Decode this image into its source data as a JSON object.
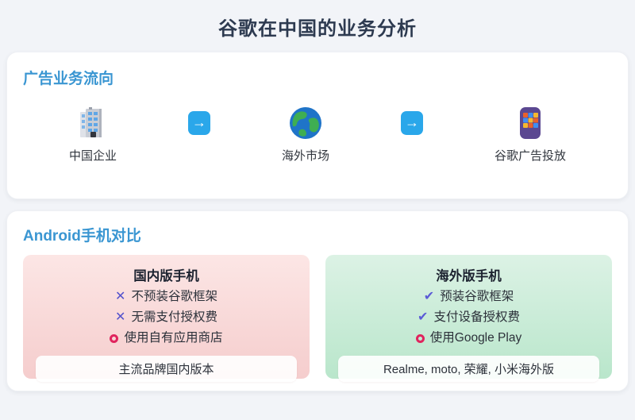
{
  "page": {
    "title": "谷歌在中国的业务分析"
  },
  "ad_flow": {
    "heading": "广告业务流向",
    "arrow_glyph": "→",
    "nodes": [
      {
        "icon": "building-icon",
        "label": "中国企业"
      },
      {
        "icon": "globe-icon",
        "label": "海外市场"
      },
      {
        "icon": "phone-icon",
        "label": "谷歌广告投放"
      }
    ]
  },
  "comparison": {
    "heading": "Android手机对比",
    "domestic": {
      "title": "国内版手机",
      "items": [
        {
          "mark": "cross",
          "glyph": "✕",
          "text": "不预装谷歌框架"
        },
        {
          "mark": "cross",
          "glyph": "✕",
          "text": "无需支付授权费"
        },
        {
          "mark": "ring",
          "glyph": "",
          "text": "使用自有应用商店"
        }
      ],
      "footer": "主流品牌国内版本"
    },
    "overseas": {
      "title": "海外版手机",
      "items": [
        {
          "mark": "check",
          "glyph": "✔",
          "text": "预装谷歌框架"
        },
        {
          "mark": "check",
          "glyph": "✔",
          "text": "支付设备授权费"
        },
        {
          "mark": "ring",
          "glyph": "",
          "text": "使用Google Play"
        }
      ],
      "footer": "Realme, moto, 荣耀, 小米海外版"
    }
  },
  "colors": {
    "page_background": "#f2f4f8",
    "accent_blue": "#3a96d2",
    "arrow_blue": "#2aa7ea",
    "title_navy": "#2d3a50",
    "mark_purple": "#5b5bd6",
    "mark_red": "#e0245e",
    "panel_pink_top": "#fce6e5",
    "panel_pink_bottom": "#f5cdcd",
    "panel_green_top": "#dcf2e5",
    "panel_green_bottom": "#b9e6cb"
  }
}
